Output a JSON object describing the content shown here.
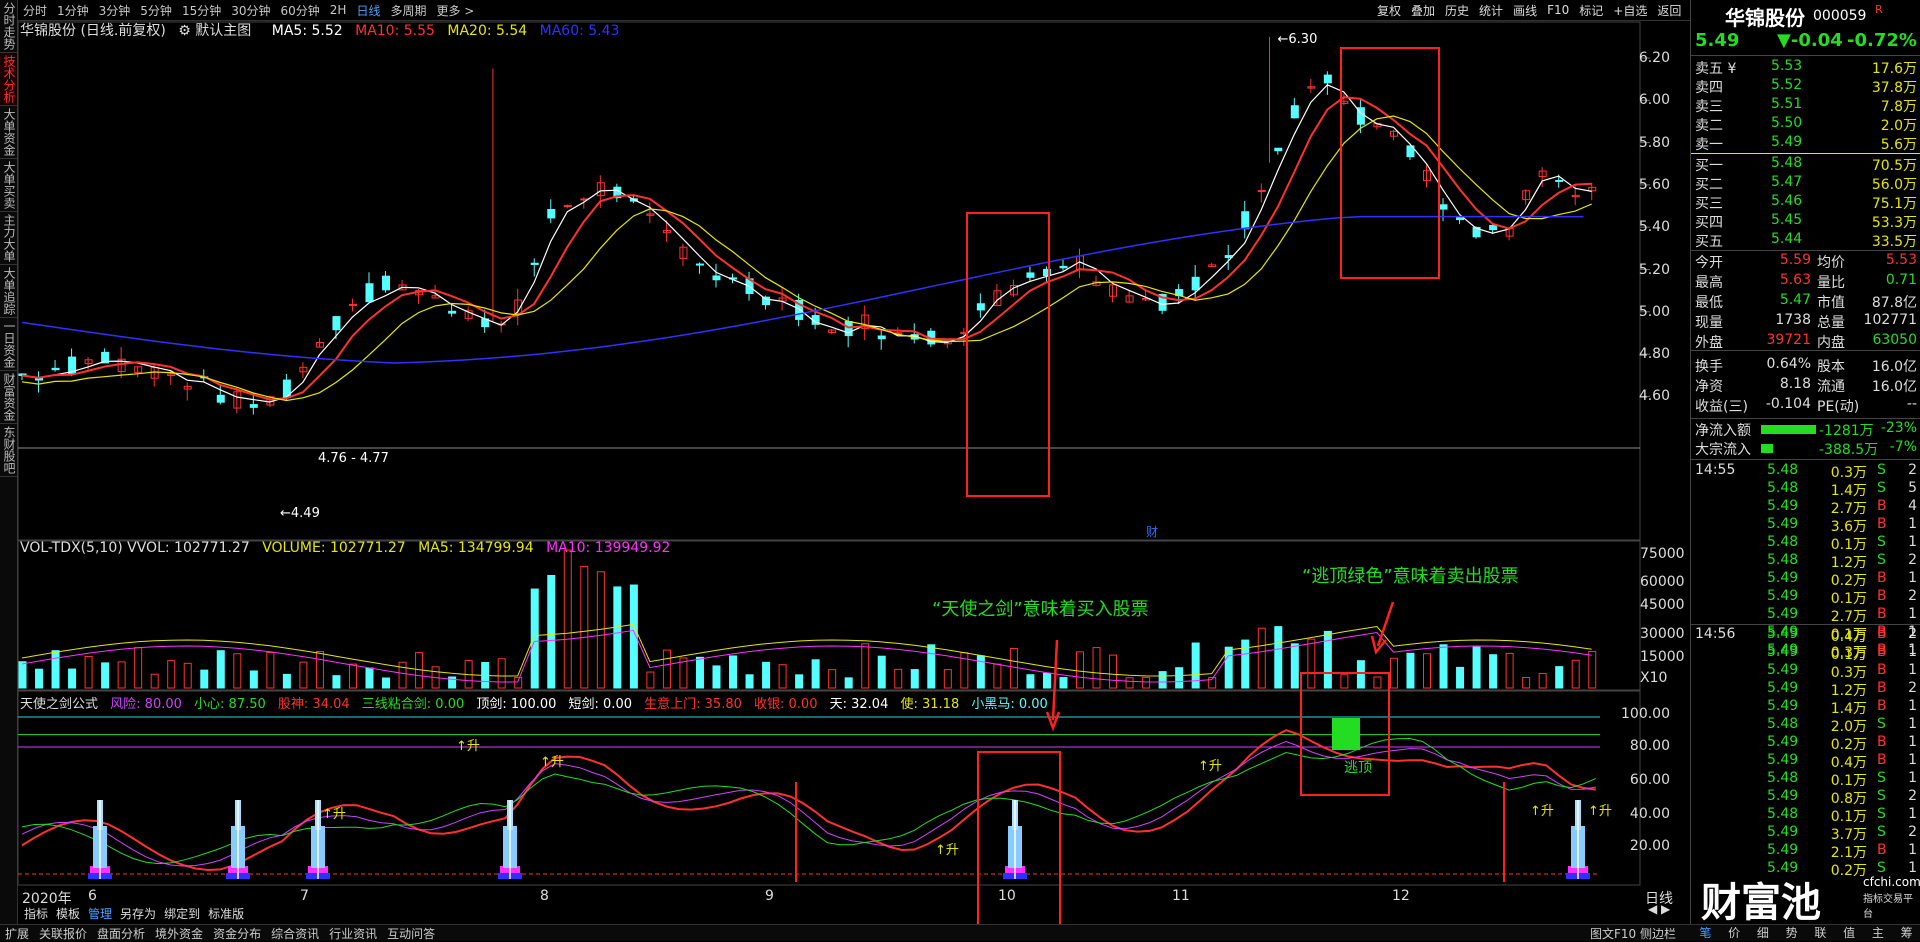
{
  "left_tabs": [
    "分时走势",
    "技术分析",
    "大单资金",
    "大单买卖",
    "主力大单",
    "大单追踪",
    "一日资金",
    "财富资金",
    "东财股吧"
  ],
  "timeframes": [
    "分时",
    "1分钟",
    "3分钟",
    "5分钟",
    "15分钟",
    "30分钟",
    "60分钟",
    "2H",
    "日线",
    "多周期",
    "更多"
  ],
  "toolbar": [
    "复权",
    "叠加",
    "历史",
    "统计",
    "画线",
    "F10",
    "标记",
    "+自选",
    "返回"
  ],
  "main_legend": {
    "name": "华锦股份 (日线.前复权)",
    "mode": "默认主图",
    "ma5": "MA5: 5.52",
    "ma10": "MA10: 5.55",
    "ma20": "MA20: 5.54",
    "ma60": "MA60: 5.43"
  },
  "price_axis": [
    "6.20",
    "6.00",
    "5.80",
    "5.60",
    "5.40",
    "5.20",
    "5.00",
    "4.80",
    "4.60"
  ],
  "price_labels": {
    "high": "6.30",
    "low": "4.49",
    "range": "4.76 - 4.77"
  },
  "vol_legend": {
    "name": "VOL-TDX(5,10) VVOL: 102771.27",
    "vol": "VOLUME: 102771.27",
    "ma5": "MA5: 134799.94",
    "ma10": "MA10: 139949.92"
  },
  "vol_axis": [
    "75000",
    "60000",
    "45000",
    "30000",
    "15000",
    "X10"
  ],
  "ind_legend": {
    "name": "天使之剑公式",
    "risk": "风险: 80.00",
    "care": "小心: 87.50",
    "gushen": "股神: 34.04",
    "sanxian": "三线粘合剑: 0.00",
    "dingjian": "顶剑: 100.00",
    "duanjian": "短剑: 0.00",
    "shengyi": "生意上门: 35.80",
    "shouyin": "收银: 0.00",
    "tian": "天: 32.04",
    "shi": "使: 31.18",
    "xiaohei": "小黑马: 0.00"
  },
  "ind_axis": [
    "100.00",
    "80.00",
    "60.00",
    "40.00",
    "20.00"
  ],
  "ind_labels": {
    "up": "↑升",
    "escape": "逃顶"
  },
  "annotations": {
    "buy": "“天使之剑”意味着买入股票",
    "sell": "“逃顶绿色”意味着卖出股票"
  },
  "x_axis": [
    "2020年",
    "6",
    "7",
    "8",
    "9",
    "10",
    "11",
    "12"
  ],
  "x_period": "日线",
  "sub_tabs": [
    "指标",
    "模板",
    "管理",
    "另存为",
    "绑定到",
    "标准版"
  ],
  "bottom_tabs": [
    "扩展",
    "关联报价",
    "盘面分析",
    "境外资金",
    "资金分布",
    "综合资讯",
    "行业资讯",
    "互动问答"
  ],
  "bottom_right": "图文F10 侧边栏",
  "stock": {
    "name": "华锦股份",
    "code": "000059",
    "price": "5.49",
    "change": "▼-0.04",
    "pct": "-0.72%"
  },
  "asks": [
    [
      "卖五",
      "5.53",
      "17.6万"
    ],
    [
      "卖四",
      "5.52",
      "37.8万"
    ],
    [
      "卖三",
      "5.51",
      "7.8万"
    ],
    [
      "卖二",
      "5.50",
      "2.0万"
    ],
    [
      "卖一",
      "5.49",
      "5.6万"
    ]
  ],
  "bids": [
    [
      "买一",
      "5.48",
      "70.5万"
    ],
    [
      "买二",
      "5.47",
      "56.0万"
    ],
    [
      "买三",
      "5.46",
      "75.1万"
    ],
    [
      "买四",
      "5.45",
      "53.3万"
    ],
    [
      "买五",
      "5.44",
      "33.5万"
    ]
  ],
  "stats": [
    [
      "今开",
      "5.59",
      "均价",
      "5.53"
    ],
    [
      "最高",
      "5.63",
      "量比",
      "0.71"
    ],
    [
      "最低",
      "5.47",
      "市值",
      "87.8亿"
    ],
    [
      "现量",
      "1738",
      "总量",
      "102771"
    ],
    [
      "外盘",
      "39721",
      "内盘",
      "63050"
    ],
    [
      "换手",
      "0.64%",
      "股本",
      "16.0亿"
    ],
    [
      "净资",
      "8.18",
      "流通",
      "16.0亿"
    ],
    [
      "收益(三)",
      "-0.104",
      "PE(动)",
      "--"
    ]
  ],
  "flows": [
    [
      "净流入额",
      "-1281万",
      "-23%"
    ],
    [
      "大宗流入",
      "-388.5万",
      "-7%"
    ]
  ],
  "ticks1_time": "14:55",
  "ticks1": [
    [
      "5.48",
      "0.3万",
      "S",
      "2"
    ],
    [
      "5.48",
      "1.4万",
      "S",
      "5"
    ],
    [
      "5.49",
      "2.7万",
      "B",
      "4"
    ],
    [
      "5.49",
      "3.6万",
      "B",
      "1"
    ],
    [
      "5.48",
      "0.1万",
      "S",
      "1"
    ],
    [
      "5.48",
      "1.2万",
      "S",
      "2"
    ],
    [
      "5.49",
      "0.2万",
      "B",
      "1"
    ],
    [
      "5.49",
      "0.1万",
      "B",
      "2"
    ],
    [
      "5.49",
      "2.7万",
      "B",
      "1"
    ],
    [
      "5.49",
      "0.1万",
      "B",
      "1"
    ],
    [
      "5.49",
      "0.3万",
      "B",
      "1"
    ]
  ],
  "ticks2_time": "14:56",
  "ticks2": [
    [
      "5.49",
      "0.4万",
      "B",
      "2"
    ],
    [
      "5.49",
      "0.1万",
      "B",
      "1"
    ],
    [
      "5.49",
      "0.3万",
      "B",
      "1"
    ],
    [
      "5.49",
      "1.2万",
      "B",
      "2"
    ],
    [
      "5.49",
      "1.4万",
      "B",
      "1"
    ],
    [
      "5.48",
      "2.0万",
      "S",
      "1"
    ],
    [
      "5.49",
      "0.2万",
      "B",
      "1"
    ],
    [
      "5.49",
      "0.4万",
      "B",
      "1"
    ],
    [
      "5.48",
      "0.1万",
      "S",
      "1"
    ],
    [
      "5.49",
      "0.8万",
      "S",
      "2"
    ],
    [
      "5.48",
      "0.1万",
      "S",
      "1"
    ],
    [
      "5.49",
      "3.7万",
      "S",
      "2"
    ],
    [
      "5.49",
      "2.1万",
      "B",
      "1"
    ],
    [
      "5.49",
      "0.2万",
      "S",
      "1"
    ]
  ],
  "watermark": {
    "brand": "财富池",
    "site": "cfchi.com",
    "sub": "指标交易平台"
  },
  "tick_tabs": [
    "笔",
    "价",
    "细",
    "势",
    "联",
    "值",
    "主",
    "筹"
  ],
  "colors": {
    "up": "#ff3232",
    "down": "#54ffff",
    "ma5": "#ffffff",
    "ma10": "#ff3030",
    "ma20": "#e6e600",
    "ma60": "#3030ff",
    "green": "#22dd22",
    "magenta": "#ff30ff"
  }
}
